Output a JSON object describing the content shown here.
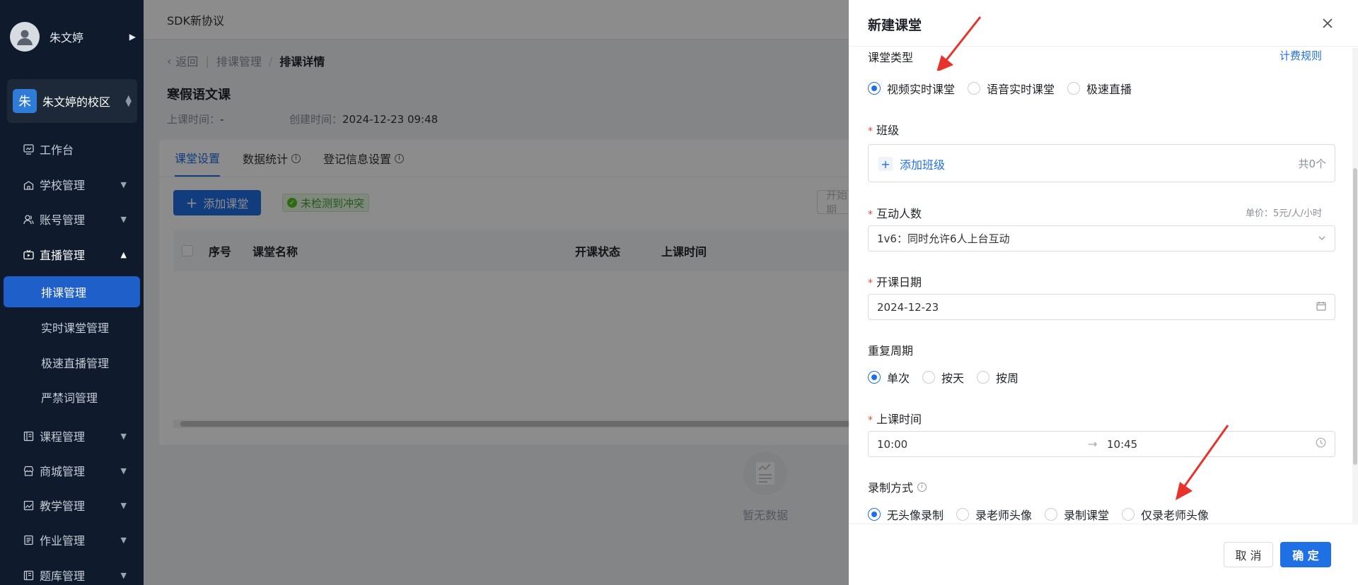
{
  "sidebar": {
    "user_name": "朱文婷",
    "campus_badge": "朱",
    "campus_name": "朱文婷的校区",
    "menu": {
      "workbench": "工作台",
      "school": "学校管理",
      "account": "账号管理",
      "live": "直播管理",
      "course": "课程管理",
      "mall": "商城管理",
      "teaching": "教学管理",
      "homework": "作业管理",
      "question_bank": "题库管理"
    },
    "live_sub": {
      "schedule": "排课管理",
      "realtime": "实时课堂管理",
      "fast_live": "极速直播管理",
      "banned_words": "严禁词管理"
    }
  },
  "main": {
    "topbar_title": "SDK新协议",
    "breadcrumb": {
      "back": "返回",
      "parent": "排课管理",
      "current": "排课详情"
    },
    "page_title": "寒假语文课",
    "meta": {
      "class_time_label": "上课时间：",
      "class_time_value": "-",
      "created_label": "创建时间：",
      "created_value": "2024-12-23 09:48"
    },
    "tabs": [
      "课堂设置",
      "数据统计",
      "登记信息设置"
    ],
    "add_button": "添加课堂",
    "no_conflict": "未检测到冲突",
    "start_placeholder": "开始日期",
    "table_headers": [
      "序号",
      "课堂名称",
      "开课状态",
      "上课时间"
    ],
    "empty_text": "暂无数据"
  },
  "drawer": {
    "title": "新建课堂",
    "class_type": {
      "label": "课堂类型",
      "billing_link": "计费规则",
      "options": [
        "视频实时课堂",
        "语音实时课堂",
        "极速直播"
      ],
      "selected_index": 0
    },
    "class_group": {
      "label": "班级",
      "add_label": "添加班级",
      "count": "共0个"
    },
    "interactive": {
      "label": "互动人数",
      "price": "单价：5元/人/小时",
      "value": "1v6：同时允许6人上台互动"
    },
    "start_date": {
      "label": "开课日期",
      "value": "2024-12-23"
    },
    "repeat": {
      "label": "重复周期",
      "options": [
        "单次",
        "按天",
        "按周"
      ],
      "selected_index": 0
    },
    "class_time": {
      "label": "上课时间",
      "start": "10:00",
      "end": "10:45"
    },
    "recording": {
      "label": "录制方式",
      "options": [
        "无头像录制",
        "录老师头像",
        "录制课堂",
        "仅录老师头像"
      ],
      "selected_index": 0
    },
    "cancel": "取 消",
    "confirm": "确 定"
  },
  "colors": {
    "primary": "#1f6fe5",
    "sidebar_bg": "#0f1b2d",
    "annotation_red": "#e8322b",
    "success": "#52c41a",
    "required": "#e8473d"
  }
}
